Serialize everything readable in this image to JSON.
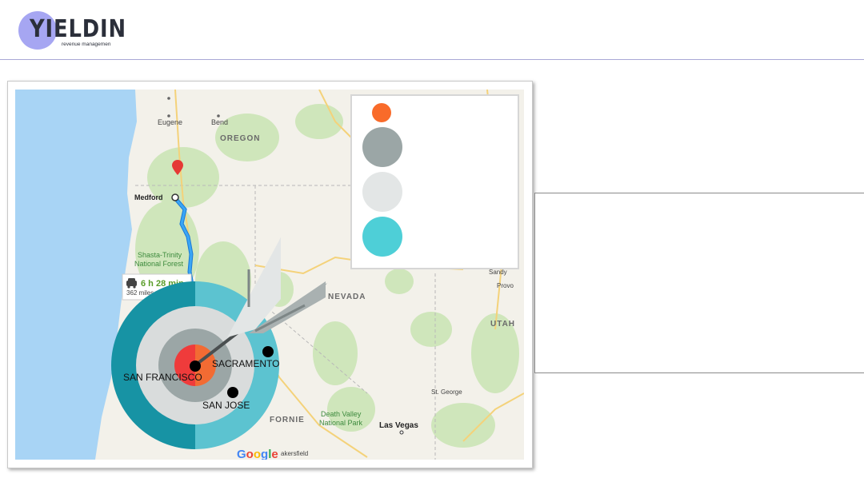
{
  "brand": {
    "name": "YIELDIN",
    "tagline": "revenue managemen",
    "accent_color": "#a6a6f2"
  },
  "map": {
    "provider_logo": "Google",
    "route": {
      "duration": "6 h 28 min",
      "distance": "362 miles",
      "icon": "car-icon"
    },
    "place_labels": {
      "eugene": "Eugene",
      "bend": "Bend",
      "oregon": "OREGON",
      "medford": "Medford",
      "shasta": "Shasta-Trinity",
      "shasta2": "National Forest",
      "nevada": "NEVADA",
      "utah": "UTAH",
      "sandy": "Sandy",
      "provo": "Provo",
      "st_george": "St. George",
      "death_valley": "Death Valley",
      "death_valley2": "National Park",
      "las_vegas": "Las Vegas",
      "california": "FORNIE",
      "bakersfield": "akersfield"
    },
    "target_labels": {
      "san_francisco": "SAN FRANCISCO",
      "sacramento": "SACRAMENTO",
      "san_jose": "SAN JOSE"
    }
  },
  "legend": {
    "swatches": [
      {
        "color": "#f96b2a",
        "size": "small"
      },
      {
        "color": "#9ba6a6",
        "size": "large"
      },
      {
        "color": "#e3e6e6",
        "size": "large"
      },
      {
        "color": "#4ecfd7",
        "size": "large"
      }
    ]
  },
  "colors": {
    "water": "#a8d4f5",
    "land": "#f3f1ea",
    "park": "#cfe6bb",
    "route": "#2b9cf0",
    "target_dark": "#1793a4",
    "target_light": "#5cc3d0",
    "target_center": "#ef3b3b",
    "target_orange": "#f26b33"
  }
}
